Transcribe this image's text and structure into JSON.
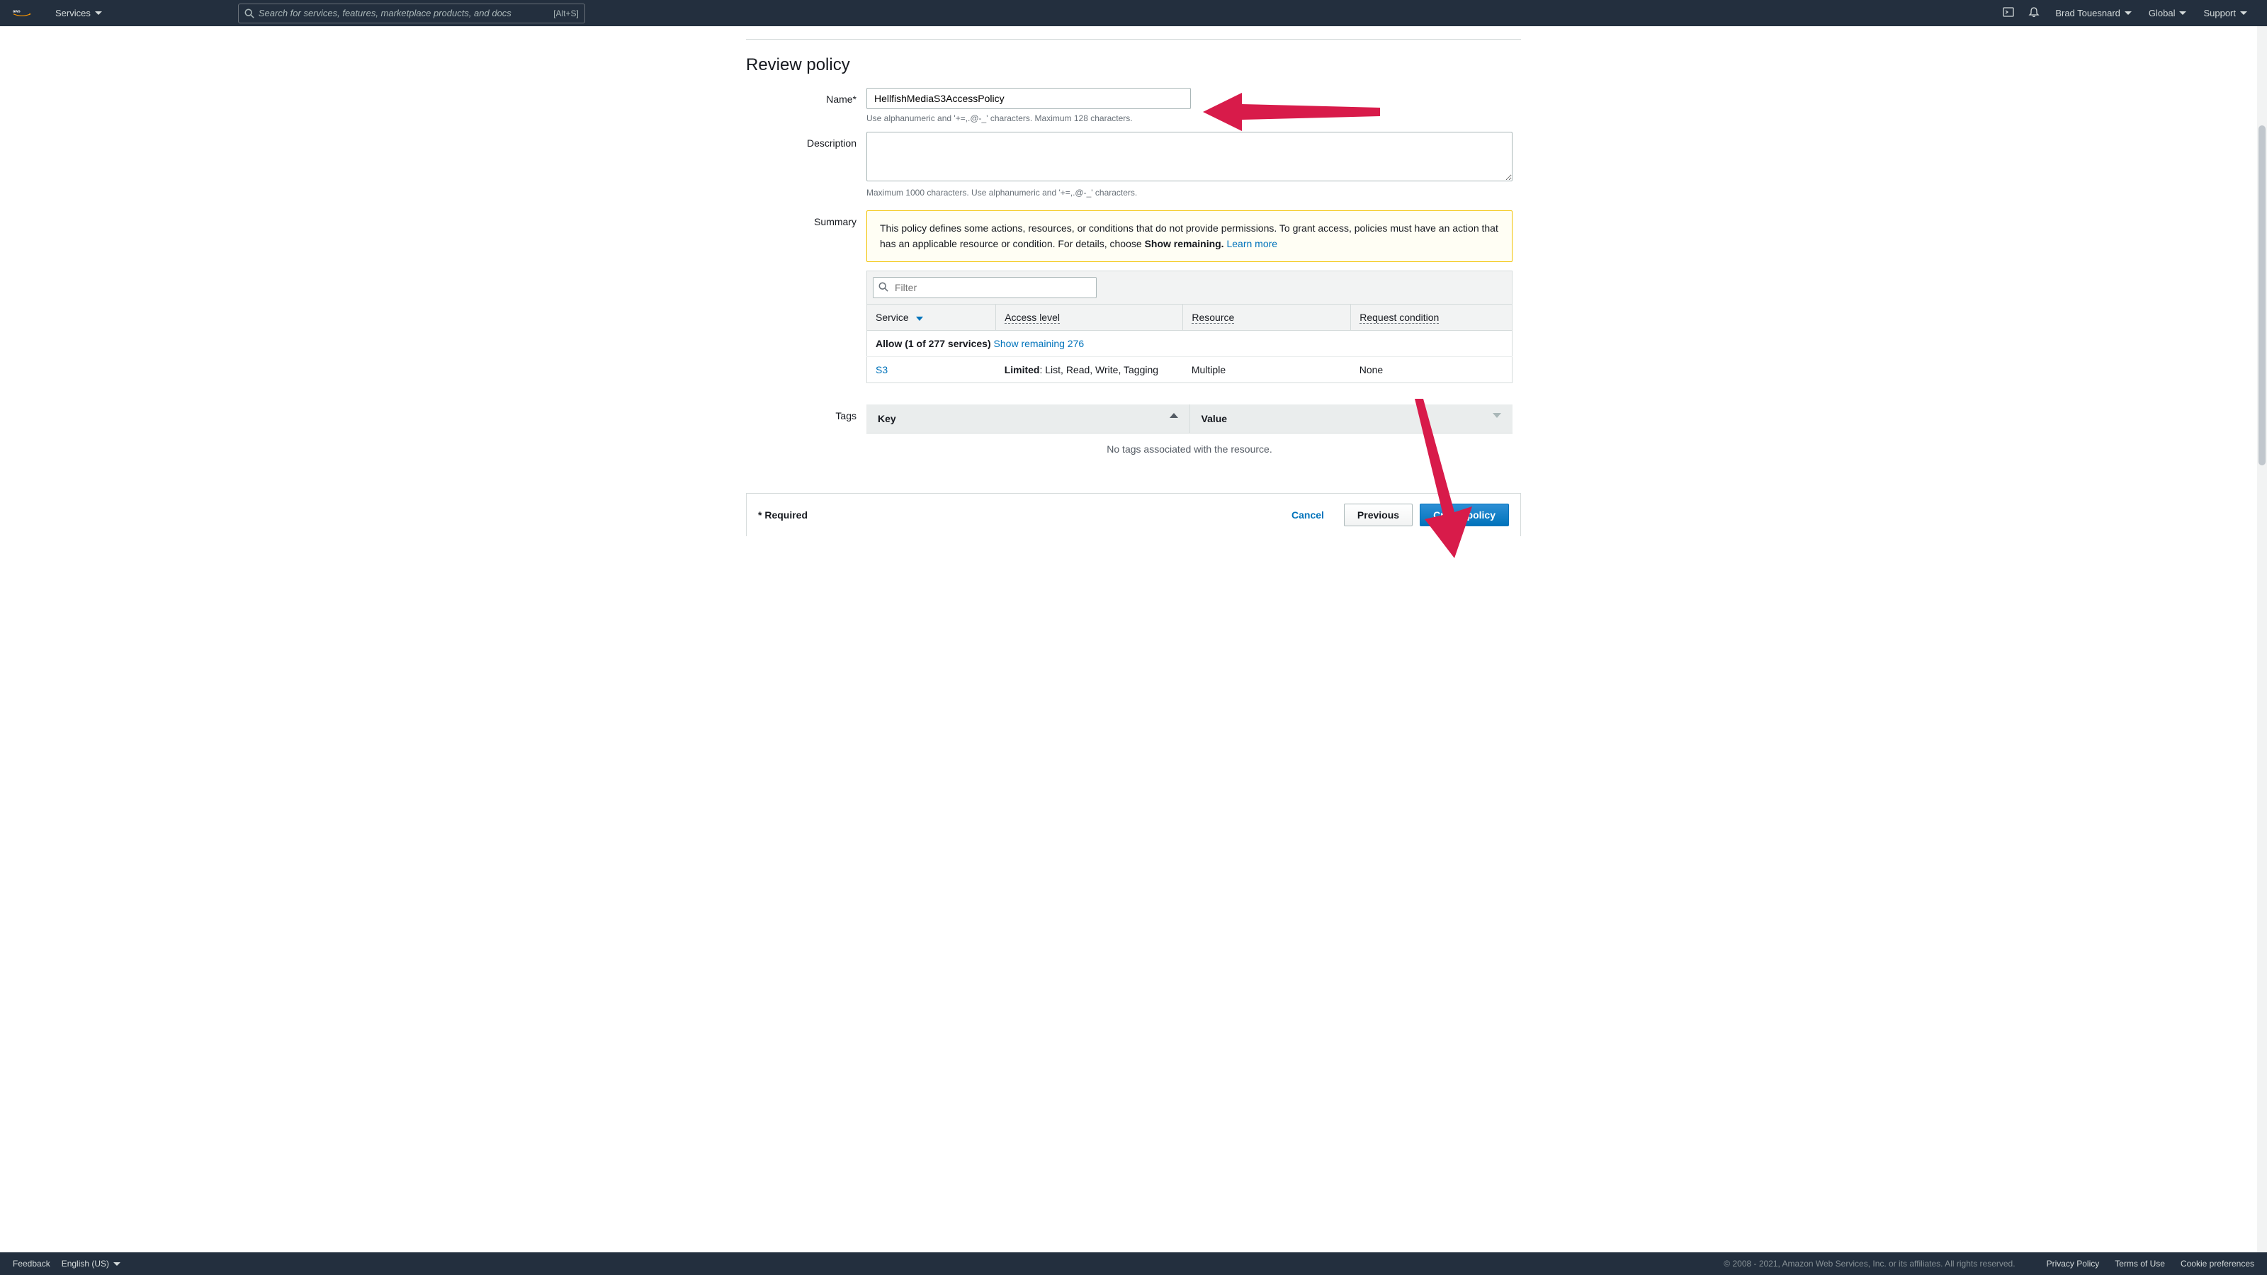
{
  "nav": {
    "services": "Services",
    "search_placeholder": "Search for services, features, marketplace products, and docs",
    "search_hint": "[Alt+S]",
    "user": "Brad Touesnard",
    "region": "Global",
    "support": "Support"
  },
  "page": {
    "title": "Review policy"
  },
  "form": {
    "name_label": "Name*",
    "name_value": "HellfishMediaS3AccessPolicy",
    "name_hint": "Use alphanumeric and '+=,.@-_' characters. Maximum 128 characters.",
    "desc_label": "Description",
    "desc_value": "",
    "desc_hint": "Maximum 1000 characters. Use alphanumeric and '+=,.@-_' characters.",
    "summary_label": "Summary",
    "tags_label": "Tags"
  },
  "summary": {
    "warning_text_1": "This policy defines some actions, resources, or conditions that do not provide permissions. To grant access, policies must have an action that has an applicable resource or condition. For details, choose ",
    "warning_bold": "Show remaining.",
    "warning_learn_more": "Learn more",
    "filter_placeholder": "Filter",
    "columns": {
      "service": "Service",
      "access_level": "Access level",
      "resource": "Resource",
      "request_condition": "Request condition"
    },
    "allow_row": {
      "prefix": "Allow (1 of 277 services)",
      "link": "Show remaining 276"
    },
    "rows": [
      {
        "service": "S3",
        "access_bold": "Limited",
        "access_rest": ": List, Read, Write, Tagging",
        "resource": "Multiple",
        "condition": "None"
      }
    ]
  },
  "tags": {
    "key_header": "Key",
    "value_header": "Value",
    "empty": "No tags associated with the resource."
  },
  "actions": {
    "required": "* Required",
    "cancel": "Cancel",
    "previous": "Previous",
    "create": "Create policy"
  },
  "footer": {
    "feedback": "Feedback",
    "language": "English (US)",
    "copyright": "© 2008 - 2021, Amazon Web Services, Inc. or its affiliates. All rights reserved.",
    "privacy": "Privacy Policy",
    "terms": "Terms of Use",
    "cookies": "Cookie preferences"
  }
}
